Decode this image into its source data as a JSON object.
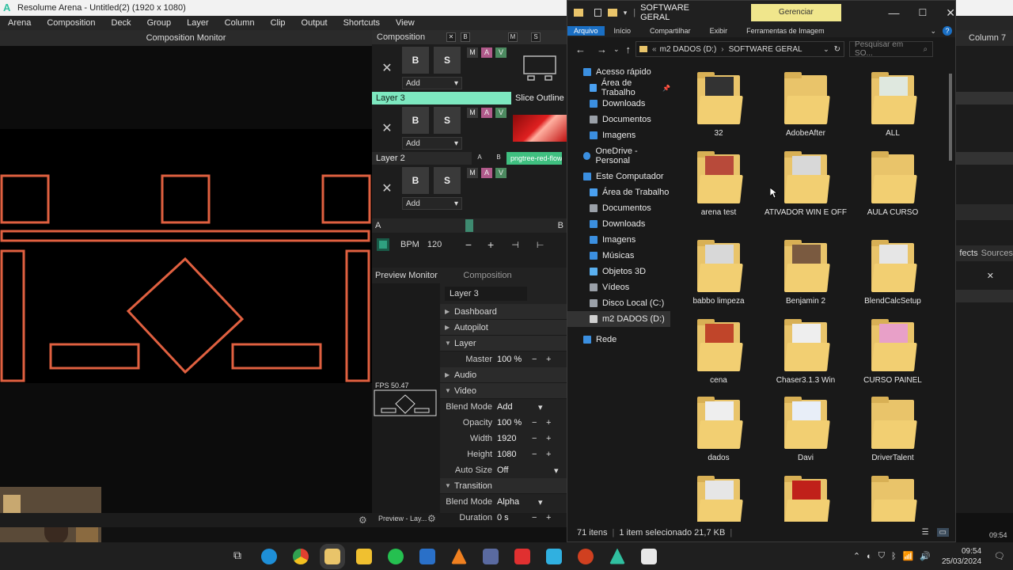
{
  "resolume": {
    "window_title": "Resolume Arena - Untitled(2) (1920 x 1080)",
    "menu": [
      "Arena",
      "Composition",
      "Deck",
      "Group",
      "Layer",
      "Column",
      "Clip",
      "Output",
      "Shortcuts",
      "View"
    ],
    "composition_monitor": "Composition Monitor",
    "composition_label": "Composition",
    "layers": [
      {
        "name": "Layer 3",
        "blend": "Add",
        "clip": "Slice Outline"
      },
      {
        "name": "Layer 2",
        "blend": "Add",
        "clip": "pngtree-red-flowi..."
      },
      {
        "name": "",
        "blend": "Add",
        "clip": ""
      }
    ],
    "crossfader_a": "A",
    "crossfader_b": "B",
    "bpm_label": "BPM",
    "bpm_value": "120",
    "preview_monitor": "Preview Monitor",
    "props_tab": "Composition",
    "selected_layer": "Layer 3",
    "fps": "FPS 50.47",
    "preview_footer": "Preview - Lay...",
    "sections": {
      "dashboard": "Dashboard",
      "autopilot": "Autopilot",
      "layer": "Layer",
      "audio": "Audio",
      "video": "Video",
      "transition": "Transition"
    },
    "params": {
      "master_label": "Master",
      "master_value": "100 %",
      "blend_label": "Blend Mode",
      "blend_value": "Add",
      "opacity_label": "Opacity",
      "opacity_value": "100 %",
      "width_label": "Width",
      "width_value": "1920",
      "height_label": "Height",
      "height_value": "1080",
      "autosize_label": "Auto Size",
      "autosize_value": "Off",
      "t_blend_label": "Blend Mode",
      "t_blend_value": "Alpha",
      "duration_label": "Duration",
      "duration_value": "0 s"
    },
    "column7": "Column 7",
    "effects_tab": "fects",
    "sources_tab": "Sources",
    "right_time": "09:54"
  },
  "explorer": {
    "title": "SOFTWARE GERAL",
    "manage_tab": "Gerenciar",
    "ribbon": [
      "Arquivo",
      "Início",
      "Compartilhar",
      "Exibir",
      "Ferramentas de Imagem"
    ],
    "path_root": "m2 DADOS (D:)",
    "path_leaf": "SOFTWARE GERAL",
    "search_placeholder": "Pesquisar em SO...",
    "nav": [
      {
        "label": "Acesso rápido",
        "level": 0,
        "color": "#3b8fe0"
      },
      {
        "label": "Área de Trabalho",
        "level": 1,
        "color": "#4aa0f0"
      },
      {
        "label": "Downloads",
        "level": 1,
        "color": "#3b8fe0"
      },
      {
        "label": "Documentos",
        "level": 1,
        "color": "#9aa0a8"
      },
      {
        "label": "Imagens",
        "level": 1,
        "color": "#3b8fe0"
      },
      {
        "label": "",
        "level": 0,
        "color": ""
      },
      {
        "label": "OneDrive - Personal",
        "level": 0,
        "color": "#3b8fe0"
      },
      {
        "label": "",
        "level": 0,
        "color": ""
      },
      {
        "label": "Este Computador",
        "level": 0,
        "color": "#3b8fe0"
      },
      {
        "label": "Área de Trabalho",
        "level": 1,
        "color": "#4aa0f0"
      },
      {
        "label": "Documentos",
        "level": 1,
        "color": "#9aa0a8"
      },
      {
        "label": "Downloads",
        "level": 1,
        "color": "#3b8fe0"
      },
      {
        "label": "Imagens",
        "level": 1,
        "color": "#3b8fe0"
      },
      {
        "label": "Músicas",
        "level": 1,
        "color": "#3b8fe0"
      },
      {
        "label": "Objetos 3D",
        "level": 1,
        "color": "#5ab0f0"
      },
      {
        "label": "Vídeos",
        "level": 1,
        "color": "#9aa0a8"
      },
      {
        "label": "Disco Local (C:)",
        "level": 1,
        "color": "#9aa0a8"
      },
      {
        "label": "m2 DADOS (D:)",
        "level": 1,
        "color": "#cfcfcf"
      },
      {
        "label": "",
        "level": 0,
        "color": ""
      },
      {
        "label": "Rede",
        "level": 0,
        "color": "#3b8fe0"
      }
    ],
    "files": [
      {
        "name": "32",
        "paper": "#333"
      },
      {
        "name": "AdobeAfter",
        "paper": ""
      },
      {
        "name": "ALL",
        "paper": "#dfe8df"
      },
      {
        "name": "arena test",
        "paper": "#b84a3a"
      },
      {
        "name": "ATIVADOR WIN E OFF",
        "paper": "#d8d8d8"
      },
      {
        "name": "AULA CURSO",
        "paper": ""
      },
      {
        "name": "babbo limpeza",
        "paper": "#d8d8d8"
      },
      {
        "name": "Benjamin 2",
        "paper": "#7a5a40"
      },
      {
        "name": "BlendCalcSetup",
        "paper": "#e6e6e6"
      },
      {
        "name": "cena",
        "paper": "#c0452a"
      },
      {
        "name": "Chaser3.1.3 Win",
        "paper": "#eeeeee"
      },
      {
        "name": "CURSO PAINEL",
        "paper": "#e8a0c8"
      },
      {
        "name": "dados",
        "paper": "#eeeeee"
      },
      {
        "name": "Davi",
        "paper": "#e8eef8"
      },
      {
        "name": "DriverTalent",
        "paper": ""
      },
      {
        "name": "",
        "paper": "#e6e6e6"
      },
      {
        "name": "",
        "paper": "#c0201a"
      },
      {
        "name": "",
        "paper": ""
      }
    ],
    "status_items": "71 itens",
    "status_selected": "1 item selecionado  21,7 KB"
  },
  "taskbar": {
    "time": "09:54",
    "date": "25/03/2024",
    "apps": [
      "task-view",
      "edge",
      "chrome",
      "file-explorer",
      "store",
      "whatsapp",
      "app-blue",
      "vlc",
      "calculator",
      "app-grid",
      "arena-blue",
      "powerpoint",
      "resolume",
      "app-misc"
    ]
  },
  "colors": {
    "layer_active": "#7de8c0",
    "shape_stroke": "#e06040",
    "folder": "#e9c46a"
  }
}
